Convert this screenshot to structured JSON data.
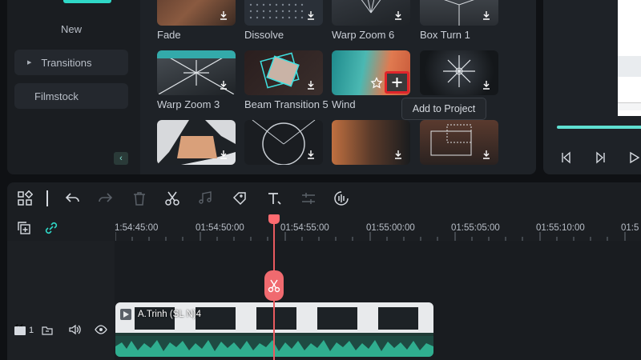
{
  "sidebar": {
    "items": [
      {
        "label": "New"
      },
      {
        "label": "Transitions"
      },
      {
        "label": "Filmstock"
      }
    ]
  },
  "transitions": [
    {
      "label": "Fade"
    },
    {
      "label": "Dissolve"
    },
    {
      "label": "Warp Zoom 6"
    },
    {
      "label": "Box Turn 1"
    },
    {
      "label": "Warp Zoom 3"
    },
    {
      "label": "Beam Transition 5"
    },
    {
      "label": "Wind"
    },
    {
      "label": ""
    }
  ],
  "tooltip": {
    "text": "Add to Project"
  },
  "ruler": {
    "ticks": [
      "1:54:45:00",
      "01:54:50:00",
      "01:54:55:00",
      "01:55:00:00",
      "01:55:05:00",
      "01:55:10:00",
      "01:5"
    ]
  },
  "track": {
    "index": "1",
    "clip_label": "A.Trinh  (SL   N)4"
  },
  "colors": {
    "accent": "#2fd8c7",
    "playhead": "#f06a6f",
    "highlight": "#e0252b",
    "waveform": "#2fae8f"
  }
}
